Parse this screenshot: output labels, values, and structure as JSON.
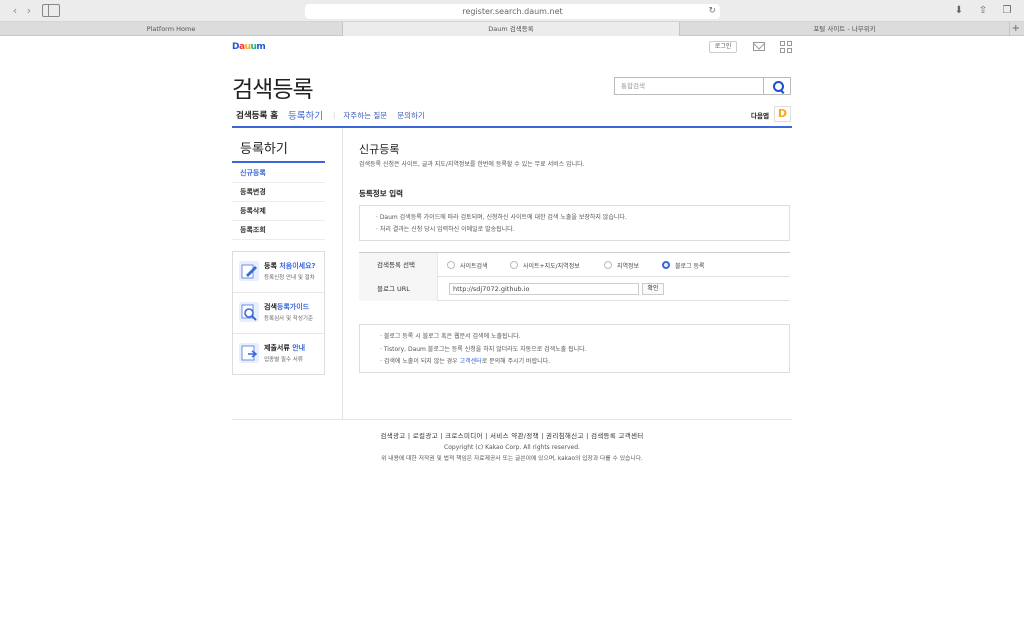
{
  "browser": {
    "url": "register.search.daum.net",
    "tabs": [
      "Platform Home",
      "Daum 검색등록",
      "포털 사이트 - 나무위키"
    ],
    "active_tab": 1,
    "new_tab": "+"
  },
  "header": {
    "logo_letters": [
      "D",
      "a",
      "u",
      "u",
      "m"
    ],
    "login_label": "로그인",
    "title": "검색등록",
    "search_placeholder": "통합검색",
    "nav": {
      "home": "검색등록 홈",
      "register": "등록하기",
      "faq": "자주하는 질문",
      "contact": "문의하기"
    },
    "daum_app_label": "다음앱",
    "daum_app_icon_letter": "D"
  },
  "sidebar": {
    "title": "등록하기",
    "items": [
      "신규등록",
      "등록변경",
      "등록삭제",
      "등록조회"
    ],
    "active_index": 0,
    "promos": [
      {
        "icon": "pencil-doc-icon",
        "head_plain": "등록 ",
        "head_blue": "처음이세요?",
        "sub": "등록신청 안내 및 절차"
      },
      {
        "icon": "magnifier-doc-icon",
        "head_plain": "검색",
        "head_blue": "등록가이드",
        "sub": "등록심사 및 작성기준"
      },
      {
        "icon": "document-check-icon",
        "head_plain": "제출서류 ",
        "head_blue": "안내",
        "sub": "업종별 필수 서류"
      }
    ]
  },
  "main": {
    "title": "신규등록",
    "description": "검색등록 신청은 사이트, 글과 지도/지역정보를 한번에 등록할 수 있는 무료 서비스 입니다.",
    "section_title": "등록정보 입력",
    "notice": [
      "· Daum 검색등록 가이드에 따라 검토되며, 신청하신 사이트에 대한 검색 노출을 보장하지 않습니다.",
      "· 처리 결과는 신청 당시 입력하신 이메일로 발송됩니다."
    ],
    "form": {
      "type_label": "검색등록 선택",
      "options": [
        "사이트검색",
        "사이트+지도/지역정보",
        "지역정보",
        "블로그 등록"
      ],
      "selected_index": 3,
      "url_label": "블로그 URL",
      "url_value": "http://sdj7072.github.io",
      "confirm_label": "확인"
    },
    "notice2": {
      "line1": "· 블로그 등록 시 블로그 혹은 웹문서 검색에 노출됩니다.",
      "line2": "· Tistory, Daum 블로그는 등록 신청을 하지 않더라도 자동으로 검색노출 됩니다.",
      "line3_pre": "· 검색에 노출이 되지 않는 경우 ",
      "line3_link": "고객센터",
      "line3_post": "로 문의해 주시기 바랍니다."
    }
  },
  "footer": {
    "links": "검색광고 | 로컬광고 | 크로스미디어 | 서비스 약관/정책 | 권리침해신고 | 검색등록 고객센터",
    "copyright": "Copyright (c) Kakao Corp. All rights reserved.",
    "disclaimer": "위 내용에 대한 저작권 및 법적 책임은 자료제공사 또는 글쓴이에 있으며, kakao의 입장과 다를 수 있습니다."
  }
}
